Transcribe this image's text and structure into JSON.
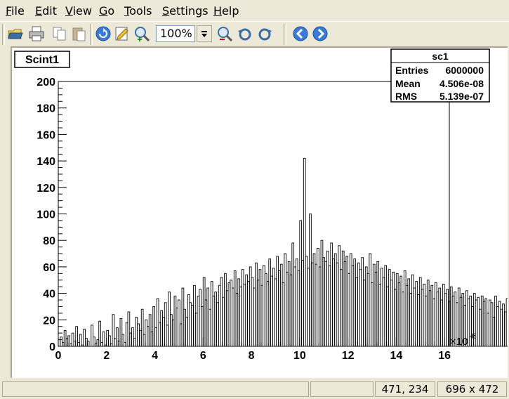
{
  "menu": [
    {
      "accel": "F",
      "rest": "ile"
    },
    {
      "accel": "E",
      "rest": "dit"
    },
    {
      "accel": "V",
      "rest": "iew"
    },
    {
      "accel": "G",
      "rest": "o"
    },
    {
      "accel": "T",
      "rest": "ools"
    },
    {
      "accel": "S",
      "rest": "ettings"
    },
    {
      "accel": "H",
      "rest": "elp"
    }
  ],
  "toolbar": {
    "zoom_value": "100%",
    "icons": [
      "open-icon",
      "print-icon",
      "copy-icon",
      "paste-icon",
      "reload-icon",
      "edit-icon",
      "zoom-in-icon",
      "zoom-out-icon",
      "rotate-left-icon",
      "rotate-right-icon",
      "back-icon",
      "forward-icon"
    ]
  },
  "colors": {
    "accent_blue": "#3a6ea5",
    "frame": "#aca899"
  },
  "histogram": {
    "title": "Scint1",
    "stats": {
      "name": "sc1",
      "rows": [
        {
          "label": "Entries",
          "value": "6000000"
        },
        {
          "label": "Mean",
          "value": "4.506e-08"
        },
        {
          "label": "RMS",
          "value": "5.139e-07"
        }
      ]
    },
    "exponent_label": "×10",
    "exponent_sup": "-6"
  },
  "chart_data": {
    "type": "histogram",
    "title": "Scint1",
    "xlim": [
      0,
      16.2
    ],
    "ylim": [
      0,
      200
    ],
    "x_ticks": [
      "0",
      "2",
      "4",
      "6",
      "8",
      "10",
      "12",
      "14",
      "16"
    ],
    "y_ticks": [
      "0",
      "20",
      "40",
      "60",
      "80",
      "100",
      "120",
      "140",
      "160",
      "180",
      "200"
    ],
    "x_tick_values": [
      0,
      2,
      4,
      6,
      8,
      10,
      12,
      14,
      16
    ],
    "y_tick_values": [
      0,
      20,
      40,
      60,
      80,
      100,
      120,
      140,
      160,
      180,
      200
    ],
    "bin_width": 0.08,
    "values": [
      5,
      7,
      3,
      12,
      6,
      8,
      2,
      10,
      4,
      15,
      3,
      9,
      1,
      13,
      6,
      4,
      0,
      16,
      7,
      2,
      5,
      19,
      3,
      11,
      1,
      12,
      8,
      2,
      24,
      6,
      14,
      4,
      21,
      9,
      3,
      18,
      26,
      10,
      14,
      6,
      22,
      17,
      12,
      28,
      9,
      20,
      15,
      24,
      11,
      30,
      14,
      36,
      18,
      27,
      22,
      33,
      16,
      41,
      24,
      20,
      38,
      29,
      35,
      17,
      44,
      28,
      22,
      39,
      33,
      31,
      46,
      25,
      38,
      43,
      30,
      52,
      35,
      44,
      28,
      49,
      38,
      41,
      33,
      46,
      52,
      37,
      55,
      42,
      48,
      50,
      44,
      57,
      40,
      51,
      45,
      58,
      47,
      54,
      49,
      60,
      52,
      44,
      63,
      50,
      58,
      46,
      61,
      55,
      49,
      66,
      53,
      59,
      51,
      68,
      57,
      62,
      48,
      70,
      56,
      64,
      54,
      78,
      60,
      66,
      57,
      95,
      65,
      142,
      68,
      59,
      100,
      63,
      70,
      62,
      74,
      60,
      80,
      67,
      64,
      72,
      61,
      78,
      66,
      70,
      63,
      76,
      58,
      72,
      64,
      68,
      55,
      70,
      61,
      66,
      52,
      63,
      58,
      67,
      50,
      60,
      55,
      70,
      48,
      62,
      56,
      64,
      47,
      59,
      52,
      61,
      45,
      58,
      50,
      56,
      43,
      55,
      48,
      53,
      41,
      57,
      46,
      51,
      40,
      54,
      44,
      49,
      39,
      52,
      43,
      47,
      38,
      50,
      42,
      46,
      36,
      48,
      41,
      44,
      35,
      47,
      40,
      43,
      34,
      45,
      38,
      41,
      33,
      44,
      37,
      40,
      31,
      42,
      36,
      38,
      30,
      40,
      35,
      37,
      28,
      38,
      34,
      36,
      25,
      35,
      33,
      22,
      38,
      30,
      34,
      28,
      32,
      26,
      36,
      24,
      31,
      27,
      35,
      20,
      29,
      24,
      34,
      18,
      30,
      23,
      33,
      21,
      28,
      35,
      27
    ]
  },
  "status": {
    "coords": "471, 234",
    "size": "696 x 472"
  }
}
